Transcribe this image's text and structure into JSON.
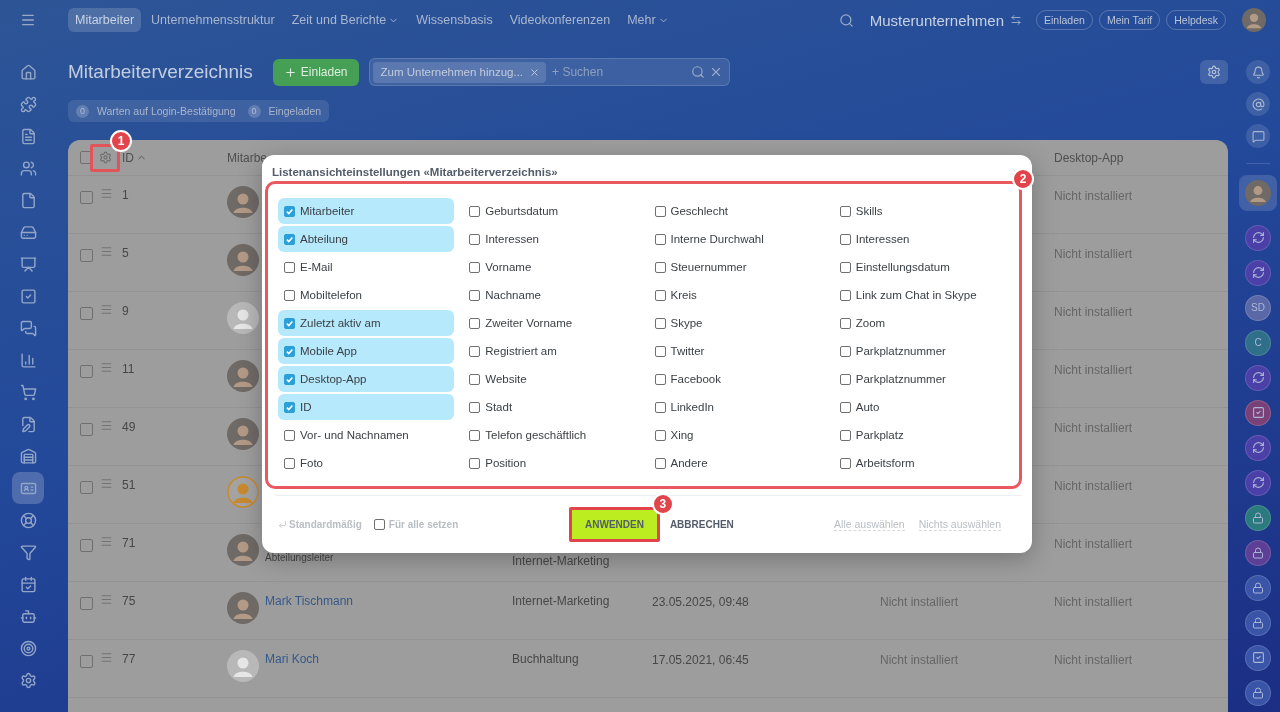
{
  "top_bar": {
    "tabs": [
      {
        "label": "Mitarbeiter",
        "selected": true,
        "dropdown": false
      },
      {
        "label": "Unternehmensstruktur",
        "selected": false,
        "dropdown": false
      },
      {
        "label": "Zeit und Berichte",
        "selected": false,
        "dropdown": true
      },
      {
        "label": "Wissensbasis",
        "selected": false,
        "dropdown": false
      },
      {
        "label": "Videokonferenzen",
        "selected": false,
        "dropdown": false
      },
      {
        "label": "Mehr",
        "selected": false,
        "dropdown": true
      }
    ],
    "company": "Musterunternehmen",
    "buttons": [
      "Einladen",
      "Mein Tarif",
      "Helpdesk"
    ]
  },
  "left_rail": [
    {
      "selected": false
    },
    {
      "selected": false
    },
    {
      "selected": false
    },
    {
      "selected": false
    },
    {
      "selected": false
    },
    {
      "selected": false
    },
    {
      "selected": false
    },
    {
      "selected": false
    },
    {
      "selected": false
    },
    {
      "selected": false
    },
    {
      "selected": false
    },
    {
      "selected": false
    },
    {
      "selected": false
    },
    {
      "selected": true
    },
    {
      "selected": false
    },
    {
      "selected": false
    },
    {
      "selected": false
    },
    {
      "selected": false
    },
    {
      "selected": false
    },
    {
      "selected": false
    }
  ],
  "page_header": {
    "title": "Mitarbeiterverzeichnis",
    "invite_button": "Einladen",
    "filter_tag": "Zum Unternehmen hinzug...",
    "search": {
      "placeholder": "+ Suchen"
    }
  },
  "counters": [
    {
      "count": "0",
      "label": "Warten auf Login-Bestätigung"
    },
    {
      "count": "0",
      "label": "Eingeladen"
    }
  ],
  "table": {
    "header": {
      "checked": false,
      "id": "ID",
      "sort_ascending": true,
      "employee": "Mitarbe",
      "desktop_app": "Desktop-App"
    },
    "rows": [
      {
        "checked": false,
        "id": "1",
        "avatar": {
          "kind": "photo"
        },
        "desktop_app": "Nicht installiert"
      },
      {
        "checked": false,
        "id": "5",
        "avatar": {
          "kind": "photo"
        },
        "desktop_app": "Nicht installiert"
      },
      {
        "checked": false,
        "id": "9",
        "avatar": {
          "kind": "default"
        },
        "desktop_app": "Nicht installiert"
      },
      {
        "checked": false,
        "id": "11",
        "avatar": {
          "kind": "photo"
        },
        "desktop_app": "Nicht installiert"
      },
      {
        "checked": false,
        "id": "49",
        "avatar": {
          "kind": "photo"
        },
        "desktop_app": "Nicht installiert"
      },
      {
        "checked": false,
        "id": "51",
        "avatar": {
          "kind": "guest"
        },
        "desktop_app": "Nicht installiert"
      },
      {
        "checked": false,
        "id": "71",
        "avatar": {
          "kind": "photo"
        },
        "position": "Abteilungsleiter",
        "department": "Internet-Marketing",
        "desktop_app": "Nicht installiert"
      },
      {
        "checked": false,
        "id": "75",
        "avatar": {
          "kind": "photo"
        },
        "name": "Mark Tischmann",
        "department": "Internet-Marketing",
        "last_active": "23.05.2025, 09:48",
        "mobile_app": "Nicht installiert",
        "desktop_app": "Nicht installiert"
      },
      {
        "checked": false,
        "id": "77",
        "avatar": {
          "kind": "default"
        },
        "name": "Mari Koch",
        "department": "Buchhaltung",
        "last_active": "17.05.2021, 06:45",
        "mobile_app": "Nicht installiert",
        "desktop_app": "Nicht installiert"
      }
    ]
  },
  "dialog": {
    "title": "Listenansichteinstellungen «Mitarbeiterverzeichnis»",
    "columns": [
      [
        {
          "label": "Mitarbeiter",
          "checked": true
        },
        {
          "label": "Abteilung",
          "checked": true
        },
        {
          "label": "E-Mail",
          "checked": false
        },
        {
          "label": "Mobiltelefon",
          "checked": false
        },
        {
          "label": "Zuletzt aktiv am",
          "checked": true
        },
        {
          "label": "Mobile App",
          "checked": true
        },
        {
          "label": "Desktop-App",
          "checked": true
        },
        {
          "label": "ID",
          "checked": true
        },
        {
          "label": "Vor- und Nachnamen",
          "checked": false
        },
        {
          "label": "Foto",
          "checked": false
        }
      ],
      [
        {
          "label": "Geburtsdatum",
          "checked": false
        },
        {
          "label": "Interessen",
          "checked": false
        },
        {
          "label": "Vorname",
          "checked": false
        },
        {
          "label": "Nachname",
          "checked": false
        },
        {
          "label": "Zweiter Vorname",
          "checked": false
        },
        {
          "label": "Registriert am",
          "checked": false
        },
        {
          "label": "Website",
          "checked": false
        },
        {
          "label": "Stadt",
          "checked": false
        },
        {
          "label": "Telefon geschäftlich",
          "checked": false
        },
        {
          "label": "Position",
          "checked": false
        }
      ],
      [
        {
          "label": "Geschlecht",
          "checked": false
        },
        {
          "label": "Interne Durchwahl",
          "checked": false
        },
        {
          "label": "Steuernummer",
          "checked": false
        },
        {
          "label": "Kreis",
          "checked": false
        },
        {
          "label": "Skype",
          "checked": false
        },
        {
          "label": "Twitter",
          "checked": false
        },
        {
          "label": "Facebook",
          "checked": false
        },
        {
          "label": "LinkedIn",
          "checked": false
        },
        {
          "label": "Xing",
          "checked": false
        },
        {
          "label": "Andere",
          "checked": false
        }
      ],
      [
        {
          "label": "Skills",
          "checked": false
        },
        {
          "label": "Interessen",
          "checked": false
        },
        {
          "label": "Einstellungsdatum",
          "checked": false
        },
        {
          "label": "Link zum Chat in Skype",
          "checked": false
        },
        {
          "label": "Zoom",
          "checked": false
        },
        {
          "label": "Parkplatznummer",
          "checked": false
        },
        {
          "label": "Parkplatznummer",
          "checked": false
        },
        {
          "label": "Auto",
          "checked": false
        },
        {
          "label": "Parkplatz",
          "checked": false
        },
        {
          "label": "Arbeitsform",
          "checked": false
        }
      ]
    ],
    "reset": "Standardmäßig",
    "apply_all": {
      "label": "Für alle setzen",
      "checked": false
    },
    "buttons": [
      {
        "kind": "apply",
        "label": "ANWENDEN"
      },
      {
        "kind": "cancel",
        "label": "ABBRECHEN"
      }
    ],
    "links": [
      "Alle auswählen",
      "Nichts auswählen"
    ]
  },
  "right_rail": [
    {
      "kind": "bell",
      "selected": false
    },
    {
      "kind": "at",
      "selected": false
    },
    {
      "kind": "chat",
      "selected": false
    },
    {
      "kind": "avatar",
      "selected": true
    },
    {
      "kind": "logo",
      "color": "#4b3fa8",
      "selected": false
    },
    {
      "kind": "logo",
      "color": "#4b3fa8",
      "selected": false
    },
    {
      "kind": "initials",
      "text": "SD",
      "color": "#5b68a8",
      "selected": false
    },
    {
      "kind": "initials",
      "text": "C",
      "color": "#2f6f8a",
      "selected": false
    },
    {
      "kind": "logo",
      "color": "#4b3fa8",
      "selected": false
    },
    {
      "kind": "task",
      "color": "#7a4178",
      "selected": false
    },
    {
      "kind": "logo",
      "color": "#4b3fa8",
      "selected": false
    },
    {
      "kind": "logo",
      "color": "#4b3fa8",
      "selected": false
    },
    {
      "kind": "lock",
      "color": "#2b7a7e",
      "selected": false
    },
    {
      "kind": "lock",
      "color": "#5d3f96",
      "selected": false
    },
    {
      "kind": "lock",
      "color": "#3a55a8",
      "selected": false
    },
    {
      "kind": "lock",
      "color": "#3a55a8",
      "selected": false
    },
    {
      "kind": "task",
      "color": "#3a55a8",
      "selected": false
    },
    {
      "kind": "lock",
      "color": "#3a55a8",
      "selected": false
    }
  ],
  "annotations": [
    {
      "number": "1"
    },
    {
      "number": "2"
    },
    {
      "number": "3"
    }
  ]
}
